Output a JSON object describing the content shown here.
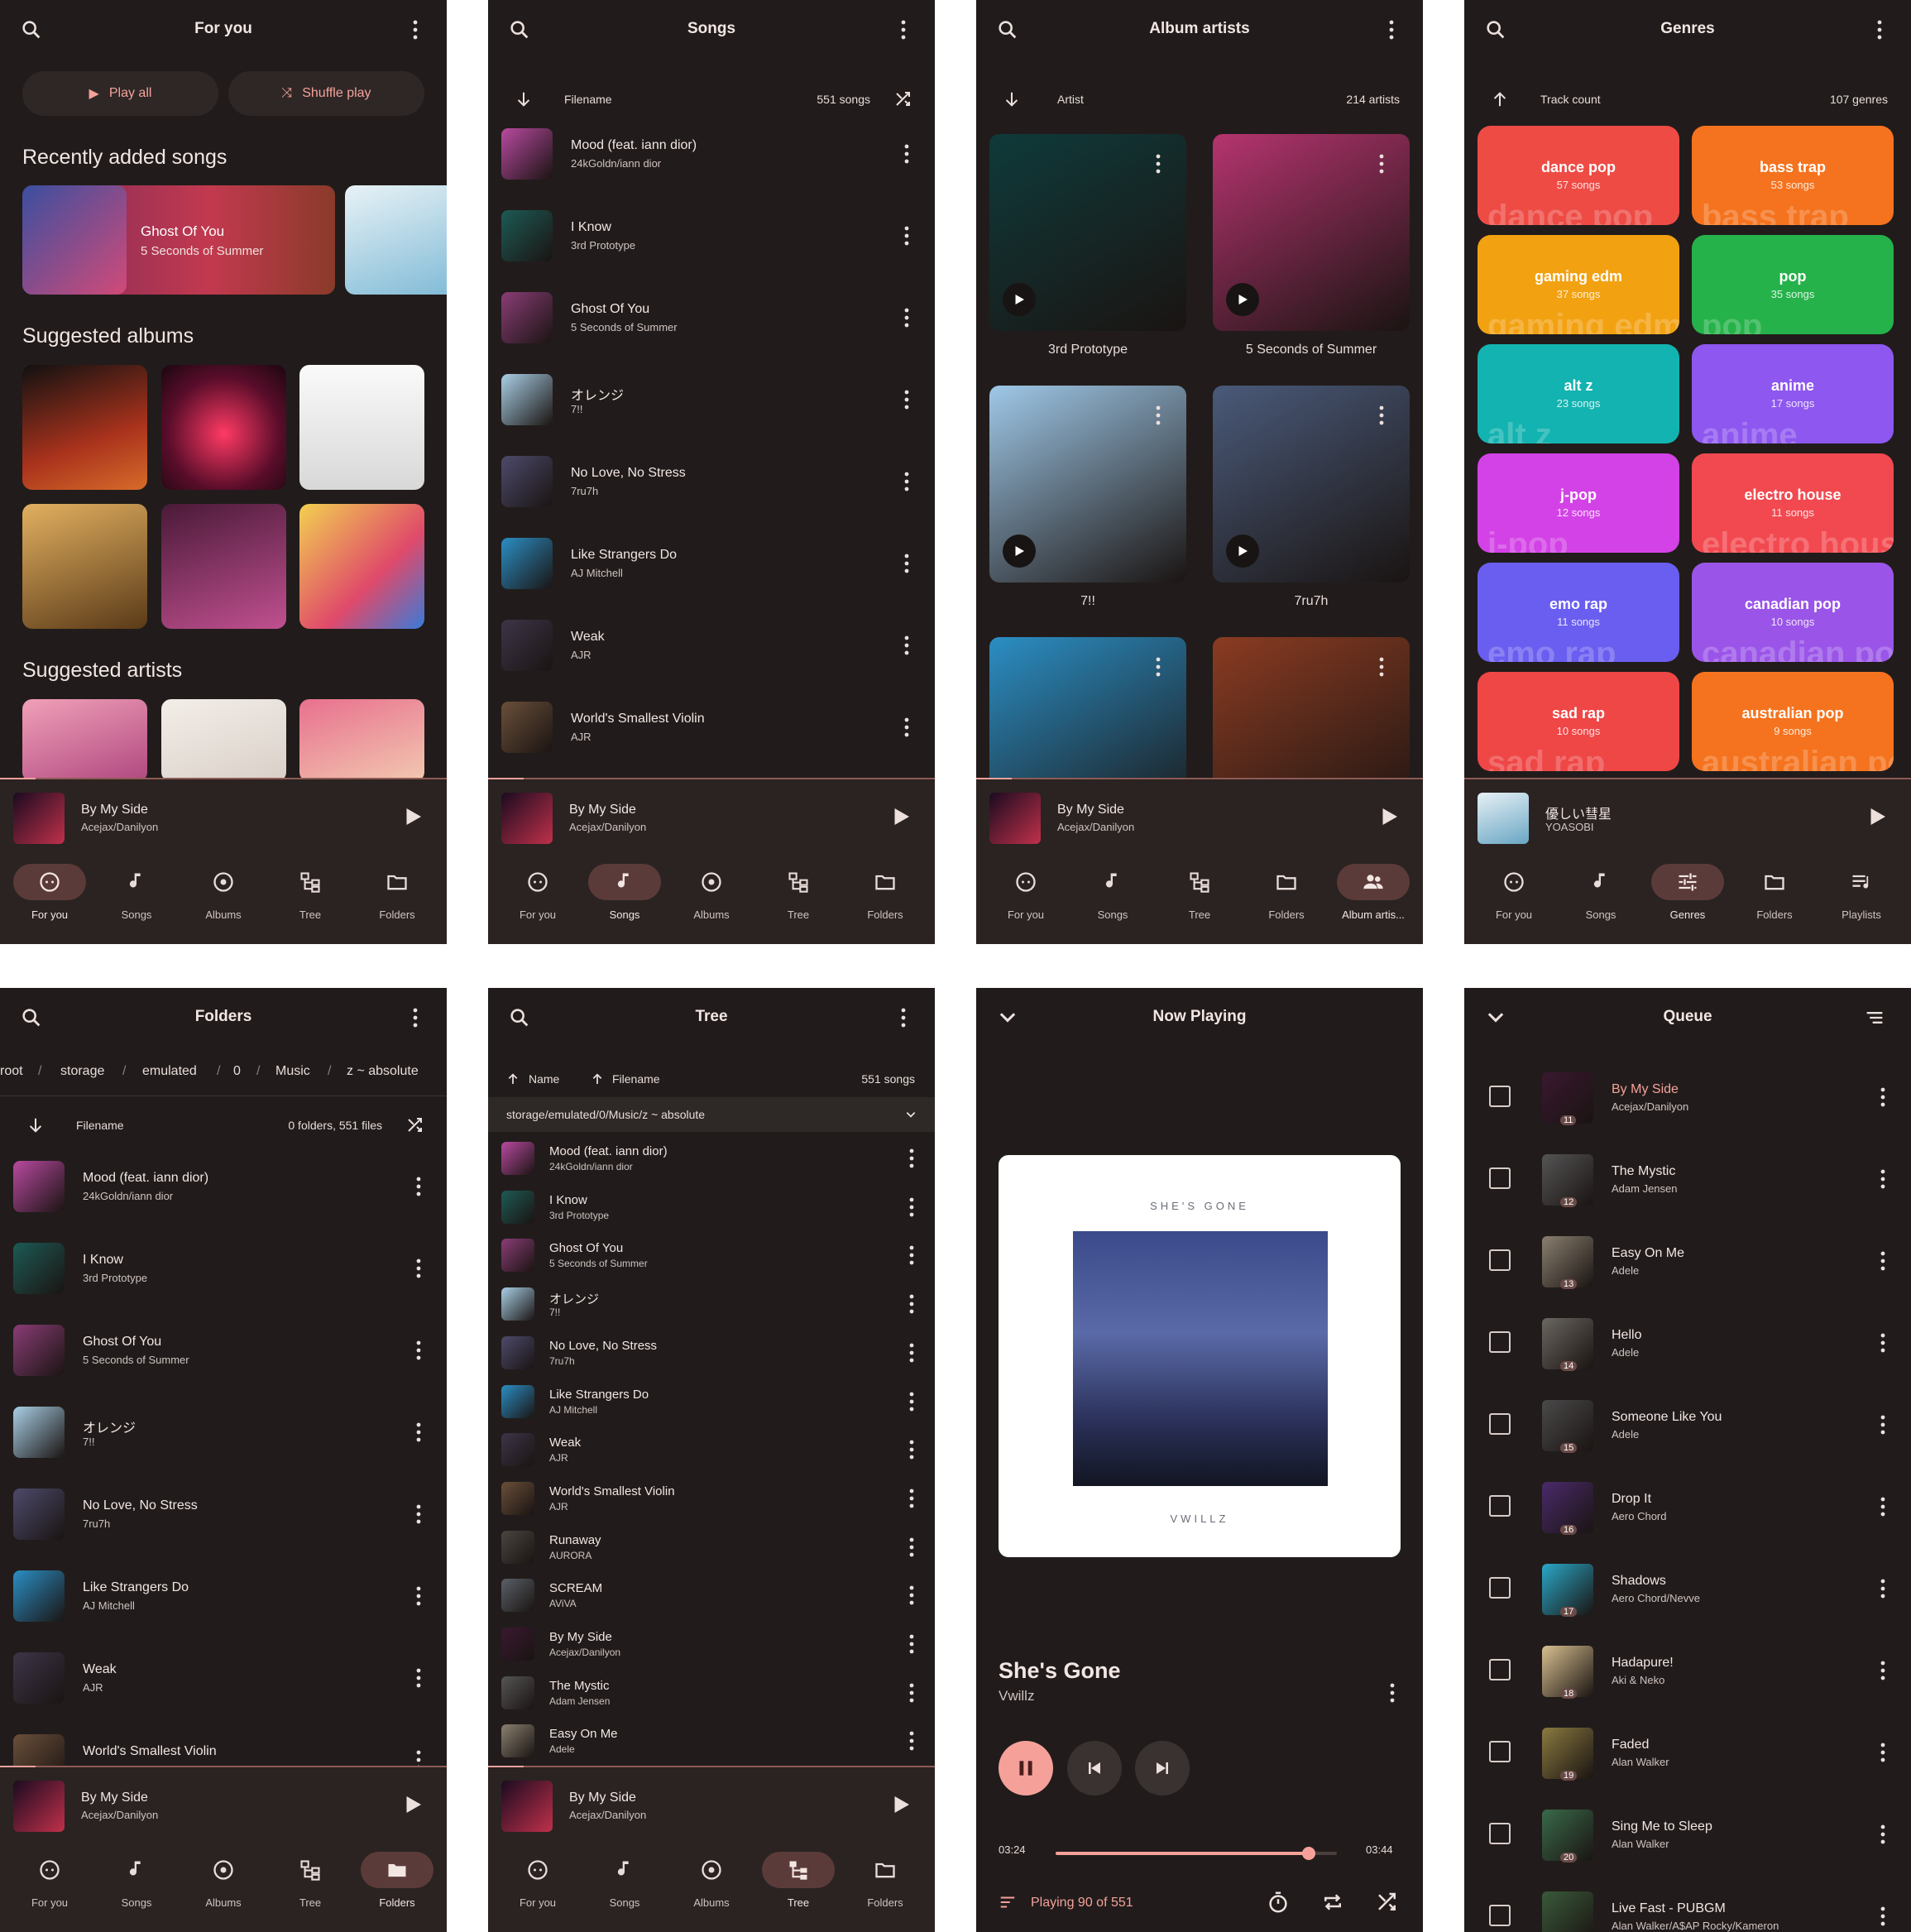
{
  "icons": {
    "search": "search-icon",
    "more": "more-vert-icon",
    "play": "play-icon",
    "shuffle": "shuffle-icon",
    "sort_down": "arrow-down-icon",
    "sort_up": "arrow-up-icon"
  },
  "colors": {
    "bg": "#211c1b",
    "surface": "#2a2321",
    "accent": "#f5a19a",
    "accent_container": "#5b3b39"
  },
  "mini": {
    "title": "By My Side",
    "artist": "Acejax/Danilyon",
    "progress": 0.08
  },
  "mini_genres": {
    "title": "優しい彗星",
    "artist": "YOASOBI"
  },
  "foryou": {
    "title": "For you",
    "play_all": "Play all",
    "shuffle_play": "Shuffle play",
    "recent_heading": "Recently added songs",
    "recent": {
      "title": "Ghost Of You",
      "artist": "5 Seconds of Summer"
    },
    "albums_heading": "Suggested albums",
    "artists_heading": "Suggested artists",
    "nav": [
      "For you",
      "Songs",
      "Albums",
      "Tree",
      "Folders"
    ]
  },
  "songs": {
    "title": "Songs",
    "sort_label": "Filename",
    "count": "551 songs",
    "list": [
      {
        "t": "Mood (feat. iann dior)",
        "s": "24kGoldn/iann dior",
        "c": "#b84aa0"
      },
      {
        "t": "I Know",
        "s": "3rd Prototype",
        "c": "#1d5a55"
      },
      {
        "t": "Ghost Of You",
        "s": "5 Seconds of Summer",
        "c": "#8a3d76"
      },
      {
        "t": "オレンジ",
        "s": "7!!",
        "c": "#a9cfe6"
      },
      {
        "t": "No Love, No Stress",
        "s": "7ru7h",
        "c": "#4d4a6b"
      },
      {
        "t": "Like Strangers Do",
        "s": "AJ Mitchell",
        "c": "#2b8ec4"
      },
      {
        "t": "Weak",
        "s": "AJR",
        "c": "#3e3448"
      },
      {
        "t": "World's Smallest Violin",
        "s": "AJR",
        "c": "#6a4f3a"
      }
    ],
    "nav": [
      "For you",
      "Songs",
      "Albums",
      "Tree",
      "Folders"
    ]
  },
  "album_artists": {
    "title": "Album artists",
    "sort_label": "Artist",
    "count": "214 artists",
    "cards": [
      {
        "name": "3rd Prototype",
        "c": "#0f3a3a"
      },
      {
        "name": "5 Seconds of Summer",
        "c": "#b5346f"
      },
      {
        "name": "7!!",
        "c": "#9fc8e8"
      },
      {
        "name": "7ru7h",
        "c": "#4a5a7a"
      },
      {
        "name": "",
        "c": "#2b8ec4"
      },
      {
        "name": "",
        "c": "#8a3b22"
      }
    ],
    "nav": [
      "For you",
      "Songs",
      "Tree",
      "Folders",
      "Album artis..."
    ]
  },
  "genres": {
    "title": "Genres",
    "sort_label": "Track count",
    "count": "107 genres",
    "list": [
      {
        "n": "dance pop",
        "c": "57 songs",
        "col": "#ee4b45"
      },
      {
        "n": "bass trap",
        "c": "53 songs",
        "col": "#f5731e"
      },
      {
        "n": "gaming edm",
        "c": "37 songs",
        "col": "#f2a111"
      },
      {
        "n": "pop",
        "c": "35 songs",
        "col": "#25b24a"
      },
      {
        "n": "alt z",
        "c": "23 songs",
        "col": "#12b3b0"
      },
      {
        "n": "anime",
        "c": "17 songs",
        "col": "#8e57f0"
      },
      {
        "n": "j-pop",
        "c": "12 songs",
        "col": "#d342e6"
      },
      {
        "n": "electro house",
        "c": "11 songs",
        "col": "#f24950"
      },
      {
        "n": "emo rap",
        "c": "11 songs",
        "col": "#6a5ef0"
      },
      {
        "n": "canadian pop",
        "c": "10 songs",
        "col": "#9a55e8"
      },
      {
        "n": "sad rap",
        "c": "10 songs",
        "col": "#ef4646"
      },
      {
        "n": "australian pop",
        "c": "9 songs",
        "col": "#f5731e"
      }
    ],
    "nav": [
      "For you",
      "Songs",
      "Genres",
      "Folders",
      "Playlists"
    ]
  },
  "folders": {
    "title": "Folders",
    "breadcrumb": [
      "root",
      "storage",
      "emulated",
      "0",
      "Music",
      "z ~ absolute"
    ],
    "sort_label": "Filename",
    "count": "0 folders, 551 files",
    "list": [
      {
        "t": "Mood (feat. iann dior)",
        "s": "24kGoldn/iann dior",
        "c": "#b84aa0"
      },
      {
        "t": "I Know",
        "s": "3rd Prototype",
        "c": "#1d5a55"
      },
      {
        "t": "Ghost Of You",
        "s": "5 Seconds of Summer",
        "c": "#8a3d76"
      },
      {
        "t": "オレンジ",
        "s": "7!!",
        "c": "#a9cfe6"
      },
      {
        "t": "No Love, No Stress",
        "s": "7ru7h",
        "c": "#4d4a6b"
      },
      {
        "t": "Like Strangers Do",
        "s": "AJ Mitchell",
        "c": "#2b8ec4"
      },
      {
        "t": "Weak",
        "s": "AJR",
        "c": "#3e3448"
      },
      {
        "t": "World's Smallest Violin",
        "s": "",
        "c": "#6a4f3a"
      }
    ],
    "nav": [
      "For you",
      "Songs",
      "Albums",
      "Tree",
      "Folders"
    ]
  },
  "tree": {
    "title": "Tree",
    "sort1": "Name",
    "sort2": "Filename",
    "count": "551 songs",
    "path": "storage/emulated/0/Music/z ~ absolute",
    "list": [
      {
        "t": "Mood (feat. iann dior)",
        "s": "24kGoldn/iann dior",
        "c": "#b84aa0"
      },
      {
        "t": "I Know",
        "s": "3rd Prototype",
        "c": "#1d5a55"
      },
      {
        "t": "Ghost Of You",
        "s": "5 Seconds of Summer",
        "c": "#8a3d76"
      },
      {
        "t": "オレンジ",
        "s": "7!!",
        "c": "#a9cfe6"
      },
      {
        "t": "No Love, No Stress",
        "s": "7ru7h",
        "c": "#4d4a6b"
      },
      {
        "t": "Like Strangers Do",
        "s": "AJ Mitchell",
        "c": "#2b8ec4"
      },
      {
        "t": "Weak",
        "s": "AJR",
        "c": "#3e3448"
      },
      {
        "t": "World's Smallest Violin",
        "s": "AJR",
        "c": "#6a4f3a"
      },
      {
        "t": "Runaway",
        "s": "AURORA",
        "c": "#4a4540"
      },
      {
        "t": "SCREAM",
        "s": "AViVA",
        "c": "#5a6068"
      },
      {
        "t": "By My Side",
        "s": "Acejax/Danilyon",
        "c": "#3a1830"
      },
      {
        "t": "The Mystic",
        "s": "Adam Jensen",
        "c": "#555"
      },
      {
        "t": "Easy On Me",
        "s": "Adele",
        "c": "#8a8070"
      }
    ],
    "nav": [
      "For you",
      "Songs",
      "Albums",
      "Tree",
      "Folders"
    ]
  },
  "now_playing": {
    "title": "Now Playing",
    "cover_top": "SHE'S GONE",
    "cover_bottom": "VWILLZ",
    "song": "She's Gone",
    "artist": "Vwillz",
    "elapsed": "03:24",
    "total": "03:44",
    "progress": 0.9,
    "playing_text": "Playing 90 of 551"
  },
  "queue": {
    "title": "Queue",
    "list": [
      {
        "t": "By My Side",
        "s": "Acejax/Danilyon",
        "n": "11",
        "c": "#3a1830"
      },
      {
        "t": "The Mystic",
        "s": "Adam Jensen",
        "n": "12",
        "c": "#555"
      },
      {
        "t": "Easy On Me",
        "s": "Adele",
        "n": "13",
        "c": "#8a8070"
      },
      {
        "t": "Hello",
        "s": "Adele",
        "n": "14",
        "c": "#6a6660"
      },
      {
        "t": "Someone Like You",
        "s": "Adele",
        "n": "15",
        "c": "#4a4a4a"
      },
      {
        "t": "Drop It",
        "s": "Aero Chord",
        "n": "16",
        "c": "#4a2a6a"
      },
      {
        "t": "Shadows",
        "s": "Aero Chord/Nevve",
        "n": "17",
        "c": "#2aa8c8"
      },
      {
        "t": "Hadapure!",
        "s": "Aki & Neko",
        "n": "18",
        "c": "#d8c090"
      },
      {
        "t": "Faded",
        "s": "Alan Walker",
        "n": "19",
        "c": "#8a7a40"
      },
      {
        "t": "Sing Me to Sleep",
        "s": "Alan Walker",
        "n": "20",
        "c": "#3a6a4a"
      },
      {
        "t": "Live Fast - PUBGM",
        "s": "Alan Walker/A$AP Rocky/Kameron",
        "n": "",
        "c": "#3a5a3a"
      }
    ]
  }
}
